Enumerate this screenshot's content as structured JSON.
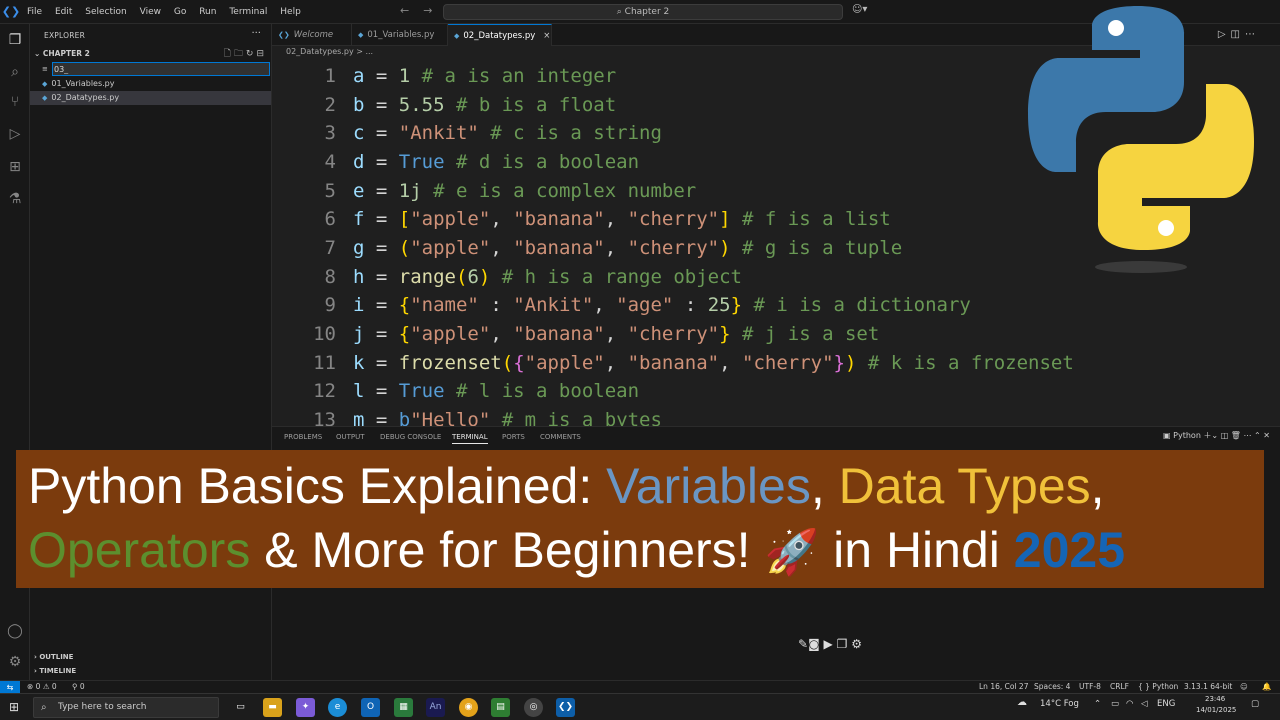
{
  "titlebar": {
    "menu": [
      "File",
      "Edit",
      "Selection",
      "View",
      "Go",
      "Run",
      "Terminal",
      "Help"
    ],
    "search_text": "Chapter 2",
    "back_icon": "arrow-left-icon",
    "forward_icon": "arrow-right-icon"
  },
  "sidebar": {
    "header": "EXPLORER",
    "folder": "CHAPTER 2",
    "new_file_value": "03_",
    "files": [
      "01_Variables.py",
      "02_Datatypes.py"
    ],
    "outline": "OUTLINE",
    "timeline": "TIMELINE"
  },
  "tabs": [
    {
      "label": "Welcome"
    },
    {
      "label": "01_Variables.py"
    },
    {
      "label": "02_Datatypes.py",
      "close": "×"
    }
  ],
  "breadcrumb": "02_Datatypes.py > ...",
  "editor": {
    "line_numbers": [
      "1",
      "2",
      "3",
      "4",
      "5",
      "6",
      "7",
      "8",
      "9",
      "10",
      "11",
      "12",
      "13"
    ]
  },
  "panel": {
    "tabs": [
      "PROBLEMS",
      "OUTPUT",
      "DEBUG CONSOLE",
      "TERMINAL",
      "PORTS",
      "COMMENTS"
    ],
    "active_tab": "TERMINAL",
    "terminal_name": "Python"
  },
  "banner": {
    "part1": "Python Basics Explained: ",
    "variables": "Variables",
    "comma1": ", ",
    "datatypes": "Data Types",
    "comma2": ",",
    "operators": "Operators",
    "part2": " & More for Beginners! ",
    "rocket": "🚀",
    "part3": " in Hindi ",
    "year": "2025"
  },
  "statusbar": {
    "errors": "⊗ 0 ⚠ 0",
    "ports": "⚲ 0",
    "position": "Ln 16, Col 27",
    "spaces": "Spaces: 4",
    "encoding": "UTF-8",
    "eol": "CRLF",
    "language": "{ } Python",
    "interpreter": "3.13.1 64-bit"
  },
  "taskbar": {
    "search_placeholder": "Type here to search",
    "weather": "14°C  Fog",
    "lang": "ENG",
    "time": "23:46",
    "date": "14/01/2025"
  },
  "colors": {
    "accent": "#0078d4",
    "banner_bg": "#7b3b0d"
  }
}
